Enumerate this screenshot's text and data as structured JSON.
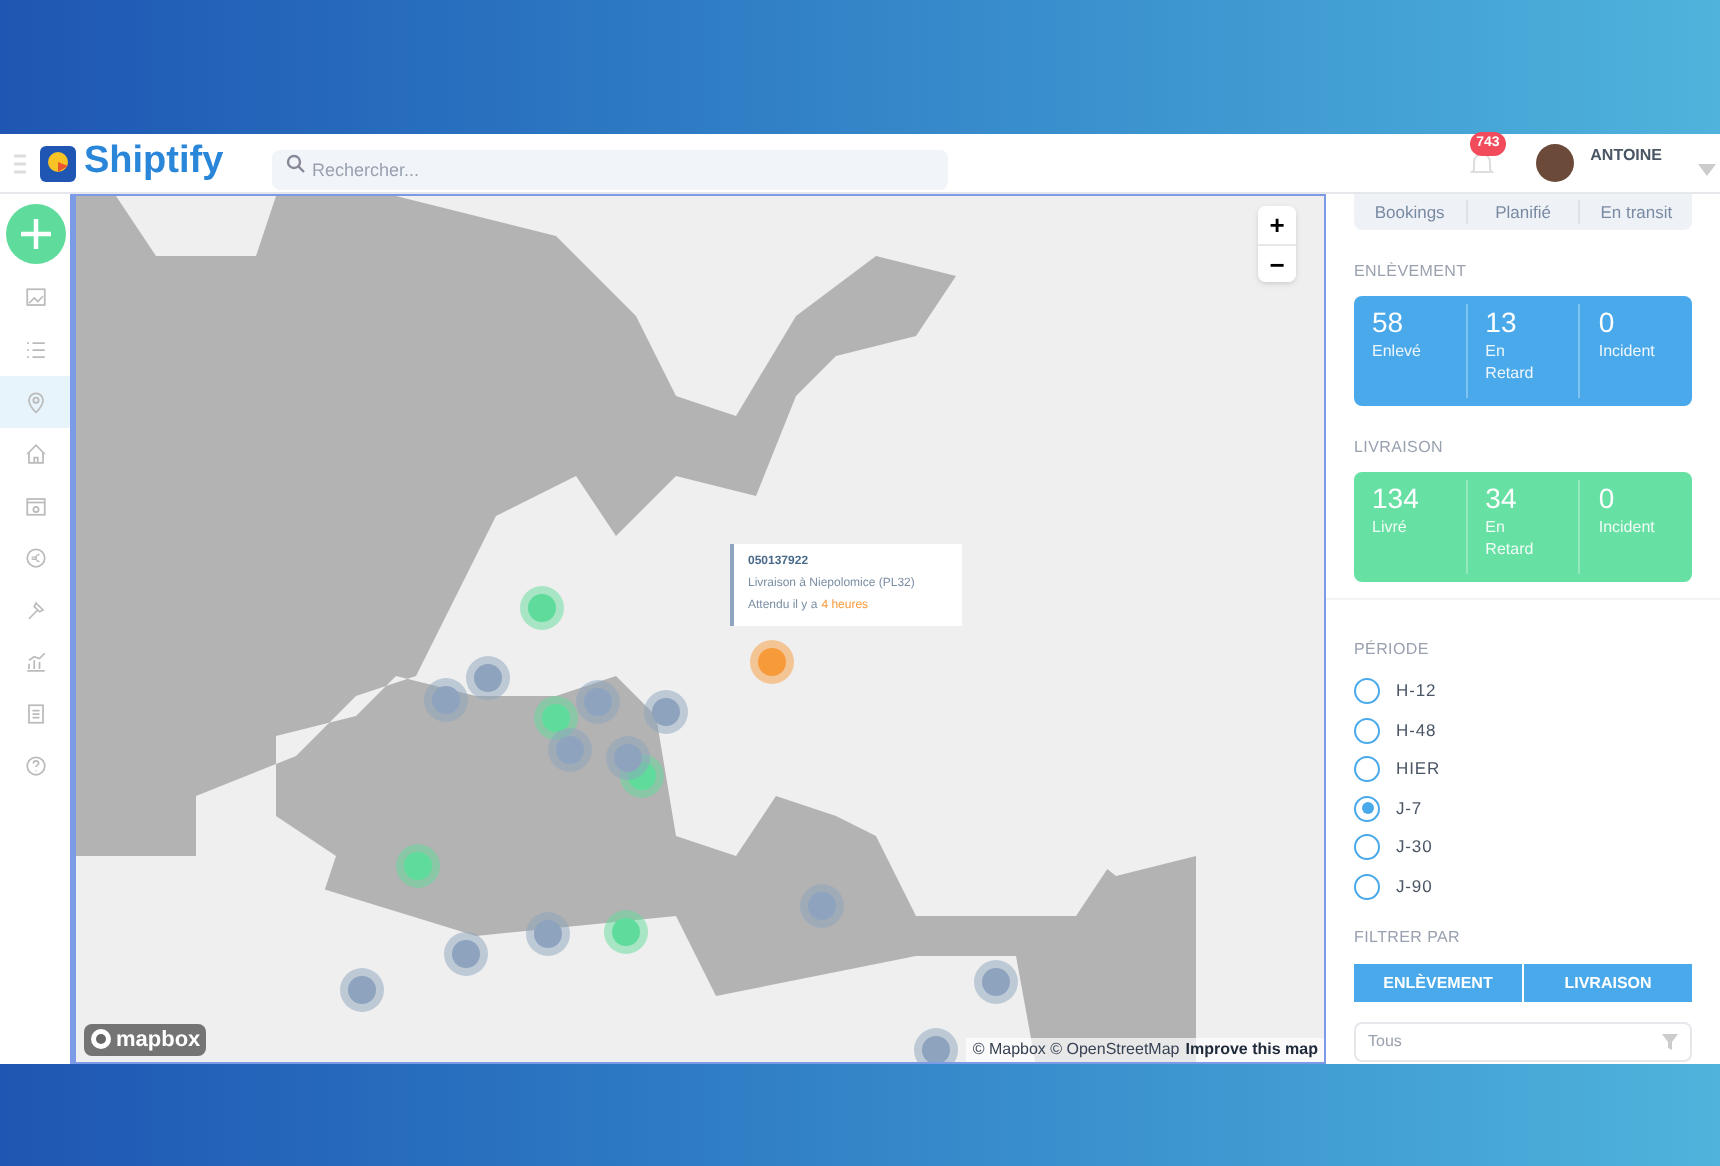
{
  "header": {
    "brand": "Shiptify",
    "search": {
      "placeholder": "Rechercher..."
    },
    "notifications": "743",
    "user": "ANTOINE"
  },
  "sidebar": {
    "items": [
      {
        "selected": false
      },
      {
        "selected": false
      },
      {
        "selected": true
      },
      {
        "selected": false
      },
      {
        "selected": false
      },
      {
        "selected": false
      },
      {
        "selected": false
      },
      {
        "selected": false
      },
      {
        "selected": false
      },
      {
        "selected": false
      }
    ]
  },
  "map": {
    "zoom_in": "+",
    "zoom_out": "−",
    "tooltip": {
      "id": "050137922",
      "line": "Livraison à Niepolomice (PL32)",
      "eta_prefix": "Attendu il y a",
      "eta_value": "4 heures"
    },
    "logo": "mapbox",
    "credits": "© Mapbox © OpenStreetMap",
    "improve": "Improve this map"
  },
  "panel": {
    "tabs": [
      "Bookings",
      "Planifié",
      "En transit"
    ],
    "sections": [
      {
        "title": "ENLÈVEMENT",
        "kind": "pickup",
        "stats": [
          {
            "value": "58",
            "label": "Enlevé"
          },
          {
            "value": "13",
            "label": "En Retard"
          },
          {
            "value": "0",
            "label": "Incident"
          }
        ]
      },
      {
        "title": "LIVRAISON",
        "kind": "delivery",
        "stats": [
          {
            "value": "134",
            "label": "Livré"
          },
          {
            "value": "34",
            "label": "En Retard"
          },
          {
            "value": "0",
            "label": "Incident"
          }
        ]
      }
    ],
    "period": {
      "title": "PÉRIODE",
      "options": [
        {
          "label": "H-12",
          "selected": false
        },
        {
          "label": "H-48",
          "selected": false
        },
        {
          "label": "HIER",
          "selected": false
        },
        {
          "label": "J-7",
          "selected": true
        },
        {
          "label": "J-30",
          "selected": false
        },
        {
          "label": "J-90",
          "selected": false
        }
      ]
    },
    "filter": {
      "title": "FILTRER PAR",
      "buttons": [
        "ENLÈVEMENT",
        "LIVRAISON"
      ],
      "select": {
        "value": "Tous"
      }
    }
  }
}
